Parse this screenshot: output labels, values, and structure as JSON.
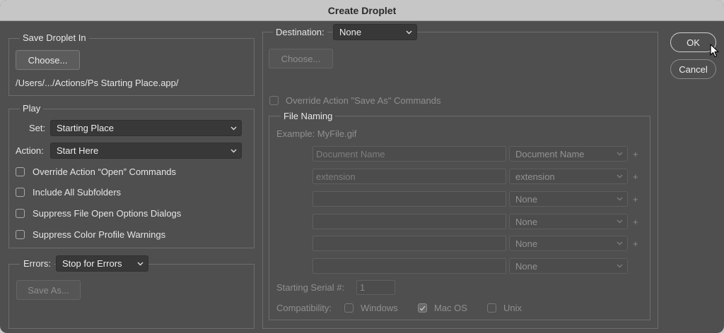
{
  "window": {
    "title": "Create Droplet"
  },
  "save_droplet_in": {
    "legend": "Save Droplet In",
    "choose_label": "Choose...",
    "path": "/Users/.../Actions/Ps Starting Place.app/"
  },
  "play": {
    "legend": "Play",
    "set_label": "Set:",
    "set_value": "Starting Place",
    "action_label": "Action:",
    "action_value": "Start Here",
    "options": [
      {
        "label": "Override Action “Open” Commands",
        "checked": false
      },
      {
        "label": "Include All Subfolders",
        "checked": false
      },
      {
        "label": "Suppress File Open Options Dialogs",
        "checked": false
      },
      {
        "label": "Suppress Color Profile Warnings",
        "checked": false
      }
    ]
  },
  "errors": {
    "label": "Errors:",
    "value": "Stop for Errors",
    "save_as_label": "Save As..."
  },
  "destination": {
    "label": "Destination:",
    "value": "None",
    "choose_label": "Choose...",
    "override_label": "Override Action \"Save As\" Commands"
  },
  "file_naming": {
    "legend": "File Naming",
    "example": "Example: MyFile.gif",
    "rows": [
      {
        "field": "Document Name",
        "select": "Document Name",
        "plus": "+"
      },
      {
        "field": "extension",
        "select": "extension",
        "plus": "+"
      },
      {
        "field": "",
        "select": "None",
        "plus": "+"
      },
      {
        "field": "",
        "select": "None",
        "plus": "+"
      },
      {
        "field": "",
        "select": "None",
        "plus": "+"
      },
      {
        "field": "",
        "select": "None",
        "plus": ""
      }
    ],
    "serial_label": "Starting Serial #:",
    "serial_value": "1",
    "compat_label": "Compatibility:",
    "compat": [
      {
        "label": "Windows",
        "checked": false
      },
      {
        "label": "Mac OS",
        "checked": true
      },
      {
        "label": "Unix",
        "checked": false
      }
    ]
  },
  "buttons": {
    "ok": "OK",
    "cancel": "Cancel"
  }
}
